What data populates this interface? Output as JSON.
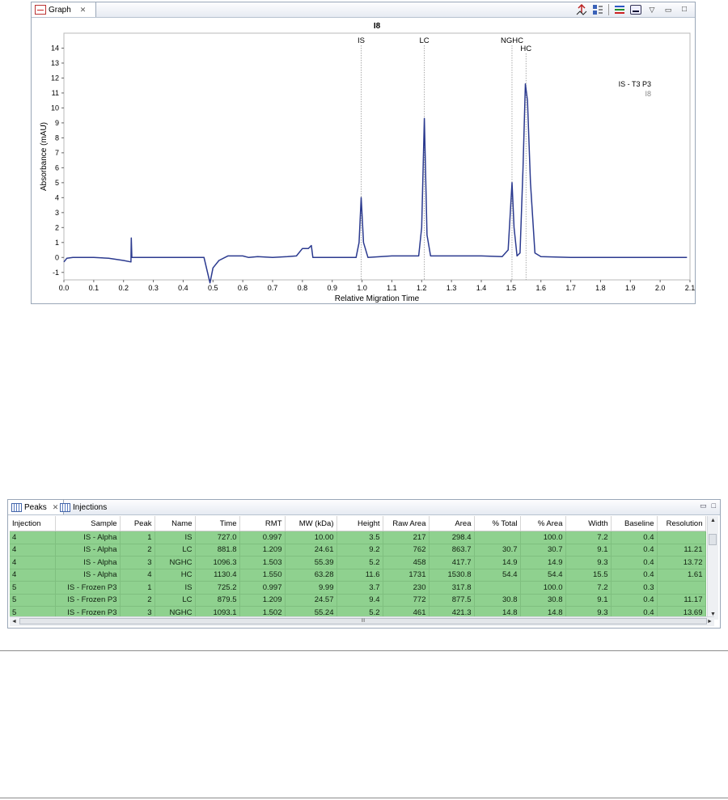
{
  "graph_panel": {
    "tab_label": "Graph",
    "tab_close": "✕",
    "toolbar": {
      "minimize": "▭",
      "maximize": "□",
      "menu": "▽"
    }
  },
  "chart_data": {
    "type": "line",
    "title": "I8",
    "xlabel": "Relative Migration Time",
    "ylabel": "Absorbance (mAU)",
    "xlim": [
      0.0,
      2.1
    ],
    "ylim": [
      -1.5,
      15.0
    ],
    "x_ticks": [
      "0.0",
      "0.1",
      "0.2",
      "0.3",
      "0.4",
      "0.5",
      "0.6",
      "0.7",
      "0.8",
      "0.9",
      "1.0",
      "1.1",
      "1.2",
      "1.3",
      "1.4",
      "1.5",
      "1.6",
      "1.7",
      "1.8",
      "1.9",
      "2.0",
      "2.1"
    ],
    "y_ticks": [
      "-1",
      "0",
      "1",
      "2",
      "3",
      "4",
      "5",
      "6",
      "7",
      "8",
      "9",
      "10",
      "11",
      "12",
      "13",
      "14"
    ],
    "peak_markers": [
      {
        "label": "IS",
        "x": 0.997
      },
      {
        "label": "LC",
        "x": 1.209
      },
      {
        "label": "NGHC",
        "x": 1.503
      },
      {
        "label": "HC",
        "x": 1.55
      }
    ],
    "legend": {
      "title": "IS - T3 P3",
      "entry": "I8",
      "position": "top-right"
    },
    "series": [
      {
        "color": "#2b3a8f",
        "points": [
          [
            0.0,
            -0.3
          ],
          [
            0.01,
            -0.05
          ],
          [
            0.03,
            0.0
          ],
          [
            0.1,
            0.0
          ],
          [
            0.15,
            -0.05
          ],
          [
            0.2,
            -0.2
          ],
          [
            0.225,
            -0.3
          ],
          [
            0.226,
            1.3
          ],
          [
            0.228,
            0.0
          ],
          [
            0.3,
            0.0
          ],
          [
            0.4,
            0.0
          ],
          [
            0.47,
            0.0
          ],
          [
            0.49,
            -1.7
          ],
          [
            0.5,
            -0.7
          ],
          [
            0.52,
            -0.2
          ],
          [
            0.55,
            0.1
          ],
          [
            0.6,
            0.1
          ],
          [
            0.62,
            0.0
          ],
          [
            0.65,
            0.05
          ],
          [
            0.7,
            0.0
          ],
          [
            0.75,
            0.05
          ],
          [
            0.78,
            0.1
          ],
          [
            0.8,
            0.6
          ],
          [
            0.82,
            0.6
          ],
          [
            0.83,
            0.8
          ],
          [
            0.835,
            0.0
          ],
          [
            0.9,
            0.0
          ],
          [
            0.98,
            0.0
          ],
          [
            0.99,
            1.0
          ],
          [
            0.997,
            4.0
          ],
          [
            1.005,
            1.0
          ],
          [
            1.02,
            0.0
          ],
          [
            1.1,
            0.1
          ],
          [
            1.19,
            0.1
          ],
          [
            1.2,
            2.0
          ],
          [
            1.209,
            9.3
          ],
          [
            1.218,
            1.5
          ],
          [
            1.23,
            0.1
          ],
          [
            1.3,
            0.1
          ],
          [
            1.4,
            0.1
          ],
          [
            1.47,
            0.05
          ],
          [
            1.49,
            0.5
          ],
          [
            1.503,
            5.0
          ],
          [
            1.51,
            2.0
          ],
          [
            1.52,
            0.1
          ],
          [
            1.53,
            0.3
          ],
          [
            1.54,
            6.0
          ],
          [
            1.548,
            11.6
          ],
          [
            1.555,
            10.5
          ],
          [
            1.565,
            5.0
          ],
          [
            1.58,
            0.3
          ],
          [
            1.6,
            0.05
          ],
          [
            1.7,
            0.0
          ],
          [
            1.8,
            0.0
          ],
          [
            1.9,
            0.0
          ],
          [
            2.0,
            0.0
          ],
          [
            2.09,
            0.0
          ]
        ]
      }
    ]
  },
  "peaks_panel": {
    "tabs": [
      {
        "label": "Peaks",
        "close": "✕"
      },
      {
        "label": "Injections"
      }
    ],
    "window_controls": {
      "minimize": "▭",
      "maximize": "□"
    },
    "columns": [
      "Injection",
      "Sample",
      "Peak",
      "Name",
      "Time",
      "RMT",
      "MW (kDa)",
      "Height",
      "Raw Area",
      "Area",
      "% Total",
      "% Area",
      "Width",
      "Baseline",
      "Resolution"
    ],
    "rows": [
      [
        "4",
        "IS - Alpha",
        "1",
        "IS",
        "727.0",
        "0.997",
        "10.00",
        "3.5",
        "217",
        "298.4",
        "",
        "100.0",
        "7.2",
        "0.4",
        ""
      ],
      [
        "4",
        "IS - Alpha",
        "2",
        "LC",
        "881.8",
        "1.209",
        "24.61",
        "9.2",
        "762",
        "863.7",
        "30.7",
        "30.7",
        "9.1",
        "0.4",
        "11.21"
      ],
      [
        "4",
        "IS - Alpha",
        "3",
        "NGHC",
        "1096.3",
        "1.503",
        "55.39",
        "5.2",
        "458",
        "417.7",
        "14.9",
        "14.9",
        "9.3",
        "0.4",
        "13.72"
      ],
      [
        "4",
        "IS - Alpha",
        "4",
        "HC",
        "1130.4",
        "1.550",
        "63.28",
        "11.6",
        "1731",
        "1530.8",
        "54.4",
        "54.4",
        "15.5",
        "0.4",
        "1.61"
      ],
      [
        "5",
        "IS - Frozen P3",
        "1",
        "IS",
        "725.2",
        "0.997",
        "9.99",
        "3.7",
        "230",
        "317.8",
        "",
        "100.0",
        "7.2",
        "0.3",
        ""
      ],
      [
        "5",
        "IS - Frozen P3",
        "2",
        "LC",
        "879.5",
        "1.209",
        "24.57",
        "9.4",
        "772",
        "877.5",
        "30.8",
        "30.8",
        "9.1",
        "0.4",
        "11.17"
      ],
      [
        "5",
        "IS - Frozen P3",
        "3",
        "NGHC",
        "1093.1",
        "1.502",
        "55.24",
        "5.2",
        "461",
        "421.3",
        "14.8",
        "14.8",
        "9.3",
        "0.4",
        "13.69"
      ]
    ],
    "scrollbar": {
      "up": "▲",
      "down": "▼",
      "left": "◄",
      "right": "►",
      "grip": "III"
    }
  }
}
